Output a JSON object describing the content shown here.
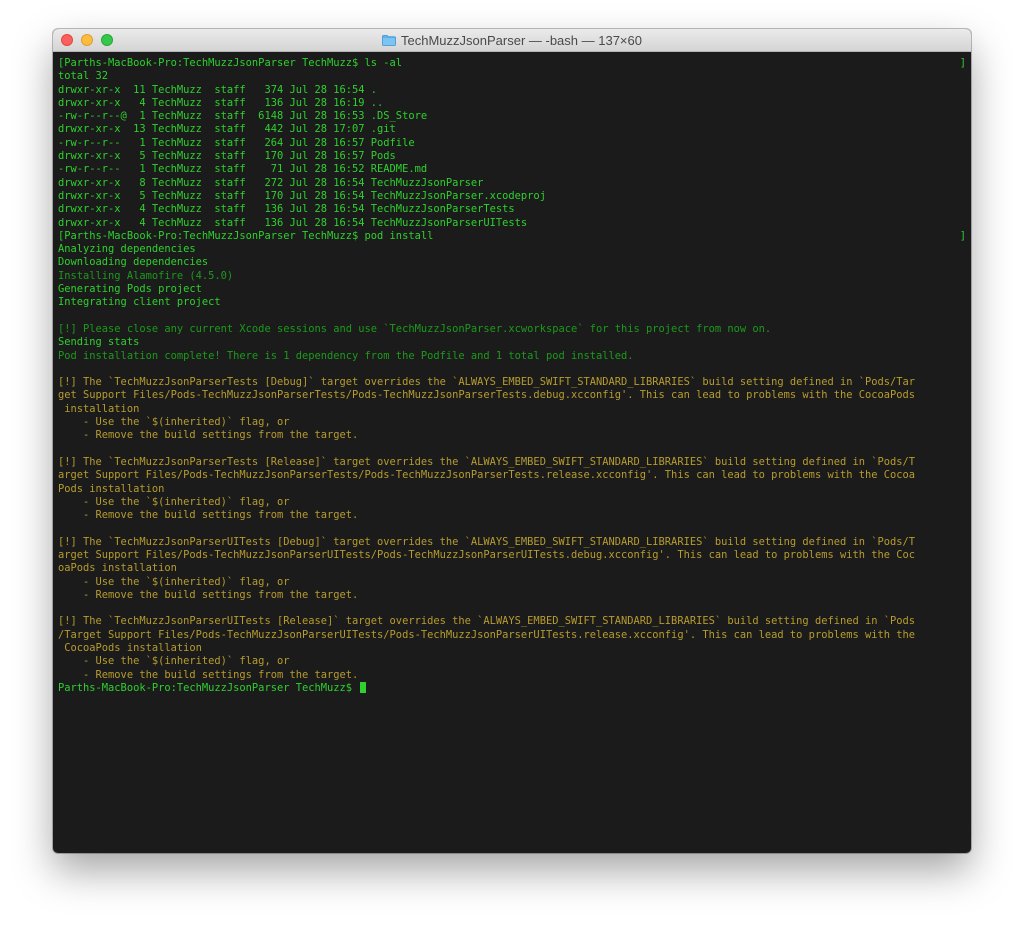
{
  "window": {
    "title": "TechMuzzJsonParser — -bash — 137×60"
  },
  "terminal": {
    "lines": [
      {
        "text": "[Parths-MacBook-Pro:TechMuzzJsonParser TechMuzz$ ls -al",
        "bracket": true
      },
      {
        "text": "total 32"
      },
      {
        "text": "drwxr-xr-x  11 TechMuzz  staff   374 Jul 28 16:54 ."
      },
      {
        "text": "drwxr-xr-x   4 TechMuzz  staff   136 Jul 28 16:19 .."
      },
      {
        "text": "-rw-r--r--@  1 TechMuzz  staff  6148 Jul 28 16:53 .DS_Store"
      },
      {
        "text": "drwxr-xr-x  13 TechMuzz  staff   442 Jul 28 17:07 .git"
      },
      {
        "text": "-rw-r--r--   1 TechMuzz  staff   264 Jul 28 16:57 Podfile"
      },
      {
        "text": "drwxr-xr-x   5 TechMuzz  staff   170 Jul 28 16:57 Pods"
      },
      {
        "text": "-rw-r--r--   1 TechMuzz  staff    71 Jul 28 16:52 README.md"
      },
      {
        "text": "drwxr-xr-x   8 TechMuzz  staff   272 Jul 28 16:54 TechMuzzJsonParser"
      },
      {
        "text": "drwxr-xr-x   5 TechMuzz  staff   170 Jul 28 16:54 TechMuzzJsonParser.xcodeproj"
      },
      {
        "text": "drwxr-xr-x   4 TechMuzz  staff   136 Jul 28 16:54 TechMuzzJsonParserTests"
      },
      {
        "text": "drwxr-xr-x   4 TechMuzz  staff   136 Jul 28 16:54 TechMuzzJsonParserUITests"
      },
      {
        "text": "[Parths-MacBook-Pro:TechMuzzJsonParser TechMuzz$ pod install",
        "bracket": true
      },
      {
        "text": "Analyzing dependencies"
      },
      {
        "text": "Downloading dependencies"
      },
      {
        "text": "Installing Alamofire (4.5.0)",
        "style": "dim"
      },
      {
        "text": "Generating Pods project"
      },
      {
        "text": "Integrating client project"
      },
      {
        "text": ""
      },
      {
        "text": "[!] Please close any current Xcode sessions and use `TechMuzzJsonParser.xcworkspace` for this project from now on.",
        "style": "dim"
      },
      {
        "text": "Sending stats"
      },
      {
        "text": "Pod installation complete! There is 1 dependency from the Podfile and 1 total pod installed.",
        "style": "dim"
      },
      {
        "text": ""
      },
      {
        "text": "[!] The `TechMuzzJsonParserTests [Debug]` target overrides the `ALWAYS_EMBED_SWIFT_STANDARD_LIBRARIES` build setting defined in `Pods/Tar",
        "style": "warn"
      },
      {
        "text": "get Support Files/Pods-TechMuzzJsonParserTests/Pods-TechMuzzJsonParserTests.debug.xcconfig'. This can lead to problems with the CocoaPods",
        "style": "warn"
      },
      {
        "text": " installation",
        "style": "warn"
      },
      {
        "text": "    - Use the `$(inherited)` flag, or",
        "style": "warn"
      },
      {
        "text": "    - Remove the build settings from the target.",
        "style": "warn"
      },
      {
        "text": ""
      },
      {
        "text": "[!] The `TechMuzzJsonParserTests [Release]` target overrides the `ALWAYS_EMBED_SWIFT_STANDARD_LIBRARIES` build setting defined in `Pods/T",
        "style": "warn"
      },
      {
        "text": "arget Support Files/Pods-TechMuzzJsonParserTests/Pods-TechMuzzJsonParserTests.release.xcconfig'. This can lead to problems with the Cocoa",
        "style": "warn"
      },
      {
        "text": "Pods installation",
        "style": "warn"
      },
      {
        "text": "    - Use the `$(inherited)` flag, or",
        "style": "warn"
      },
      {
        "text": "    - Remove the build settings from the target.",
        "style": "warn"
      },
      {
        "text": ""
      },
      {
        "text": "[!] The `TechMuzzJsonParserUITests [Debug]` target overrides the `ALWAYS_EMBED_SWIFT_STANDARD_LIBRARIES` build setting defined in `Pods/T",
        "style": "warn"
      },
      {
        "text": "arget Support Files/Pods-TechMuzzJsonParserUITests/Pods-TechMuzzJsonParserUITests.debug.xcconfig'. This can lead to problems with the Coc",
        "style": "warn"
      },
      {
        "text": "oaPods installation",
        "style": "warn"
      },
      {
        "text": "    - Use the `$(inherited)` flag, or",
        "style": "warn"
      },
      {
        "text": "    - Remove the build settings from the target.",
        "style": "warn"
      },
      {
        "text": ""
      },
      {
        "text": "[!] The `TechMuzzJsonParserUITests [Release]` target overrides the `ALWAYS_EMBED_SWIFT_STANDARD_LIBRARIES` build setting defined in `Pods",
        "style": "warn"
      },
      {
        "text": "/Target Support Files/Pods-TechMuzzJsonParserUITests/Pods-TechMuzzJsonParserUITests.release.xcconfig'. This can lead to problems with the",
        "style": "warn"
      },
      {
        "text": " CocoaPods installation",
        "style": "warn"
      },
      {
        "text": "    - Use the `$(inherited)` flag, or",
        "style": "warn"
      },
      {
        "text": "    - Remove the build settings from the target.",
        "style": "warn"
      },
      {
        "text": "Parths-MacBook-Pro:TechMuzzJsonParser TechMuzz$ ",
        "cursor": true
      }
    ]
  },
  "colors": {
    "background": "#1b1b1b",
    "text": "#2ed12e",
    "text_dim": "#1c9a1c",
    "warning": "#b79c2e"
  }
}
